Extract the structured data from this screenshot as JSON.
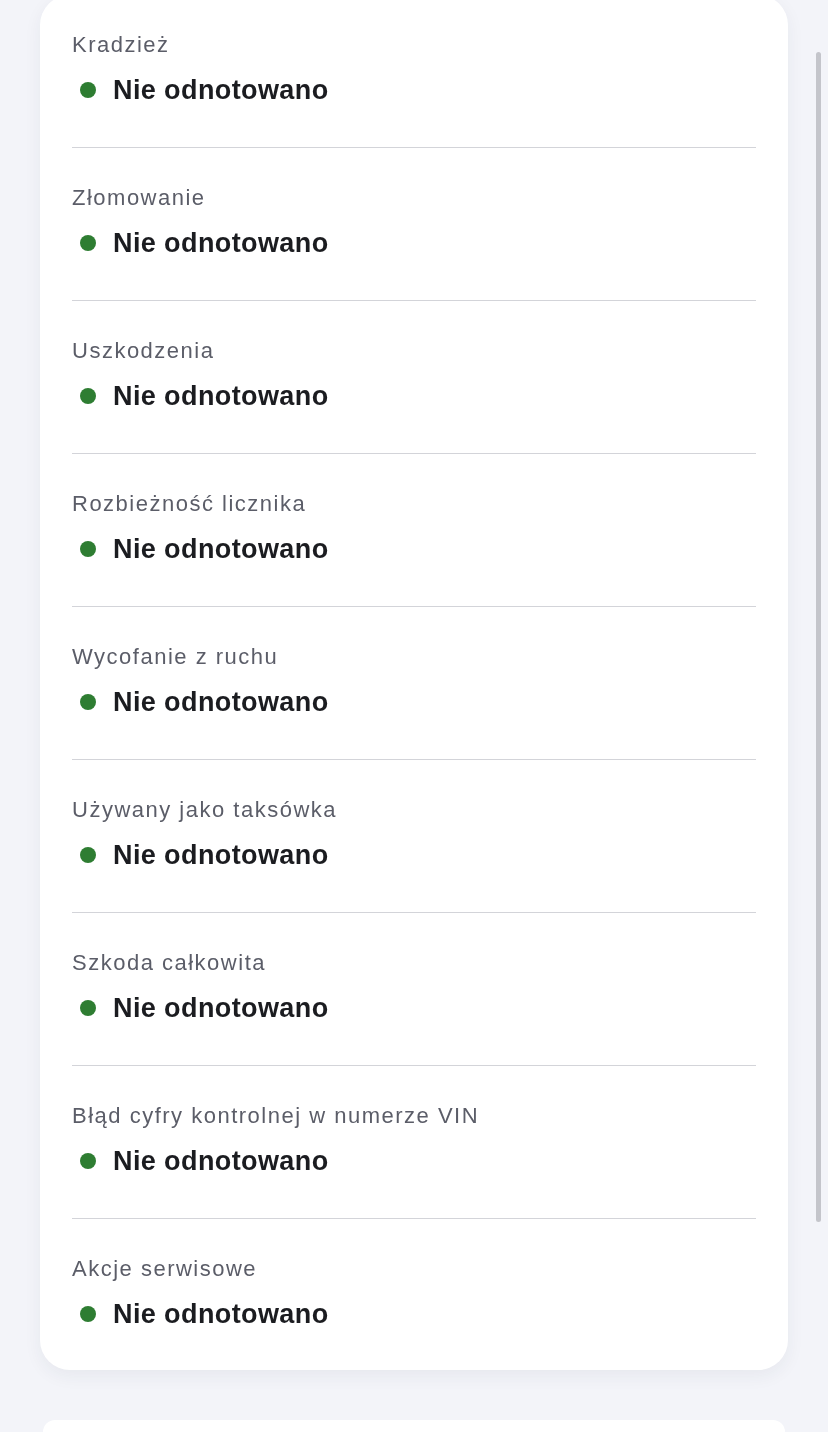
{
  "items": [
    {
      "label": "Kradzież",
      "status": "Nie odnotowano",
      "color": "#2e7d32"
    },
    {
      "label": "Złomowanie",
      "status": "Nie odnotowano",
      "color": "#2e7d32"
    },
    {
      "label": "Uszkodzenia",
      "status": "Nie odnotowano",
      "color": "#2e7d32"
    },
    {
      "label": "Rozbieżność licznika",
      "status": "Nie odnotowano",
      "color": "#2e7d32"
    },
    {
      "label": "Wycofanie z ruchu",
      "status": "Nie odnotowano",
      "color": "#2e7d32"
    },
    {
      "label": "Używany jako taksówka",
      "status": "Nie odnotowano",
      "color": "#2e7d32"
    },
    {
      "label": "Szkoda całkowita",
      "status": "Nie odnotowano",
      "color": "#2e7d32"
    },
    {
      "label": "Błąd cyfry kontrolnej w numerze VIN",
      "status": "Nie odnotowano",
      "color": "#2e7d32"
    },
    {
      "label": "Akcje serwisowe",
      "status": "Nie odnotowano",
      "color": "#2e7d32"
    }
  ]
}
